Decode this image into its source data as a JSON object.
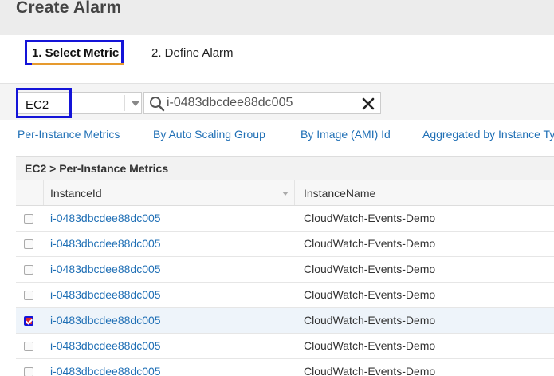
{
  "header": {
    "title": "Create Alarm"
  },
  "steps": [
    {
      "label": "1. Select Metric",
      "active": true
    },
    {
      "label": "2. Define Alarm",
      "active": false
    }
  ],
  "toolbar": {
    "namespace_value": "EC2",
    "search_value": "i-0483dbcdee88dc005"
  },
  "tabs": [
    {
      "label": "Per-Instance Metrics"
    },
    {
      "label": "By Auto Scaling Group"
    },
    {
      "label": "By Image (AMI) Id"
    },
    {
      "label": "Aggregated by Instance Type"
    }
  ],
  "table": {
    "breadcrumb": "EC2 > Per-Instance Metrics",
    "columns": [
      "InstanceId",
      "InstanceName"
    ],
    "rows": [
      {
        "instance_id": "i-0483dbcdee88dc005",
        "instance_name": "CloudWatch-Events-Demo",
        "checked": false
      },
      {
        "instance_id": "i-0483dbcdee88dc005",
        "instance_name": "CloudWatch-Events-Demo",
        "checked": false
      },
      {
        "instance_id": "i-0483dbcdee88dc005",
        "instance_name": "CloudWatch-Events-Demo",
        "checked": false
      },
      {
        "instance_id": "i-0483dbcdee88dc005",
        "instance_name": "CloudWatch-Events-Demo",
        "checked": false
      },
      {
        "instance_id": "i-0483dbcdee88dc005",
        "instance_name": "CloudWatch-Events-Demo",
        "checked": true
      },
      {
        "instance_id": "i-0483dbcdee88dc005",
        "instance_name": "CloudWatch-Events-Demo",
        "checked": false
      },
      {
        "instance_id": "i-0483dbcdee88dc005",
        "instance_name": "CloudWatch-Events-Demo",
        "checked": false
      }
    ]
  },
  "colors": {
    "link": "#1f6fb5",
    "highlight_box": "#1414d8",
    "active_step_underline": "#e69a2e",
    "checked_box": "#d9262e"
  },
  "icons": {
    "search": "search-icon",
    "clear": "close-icon",
    "dropdown": "chevron-down-icon"
  }
}
